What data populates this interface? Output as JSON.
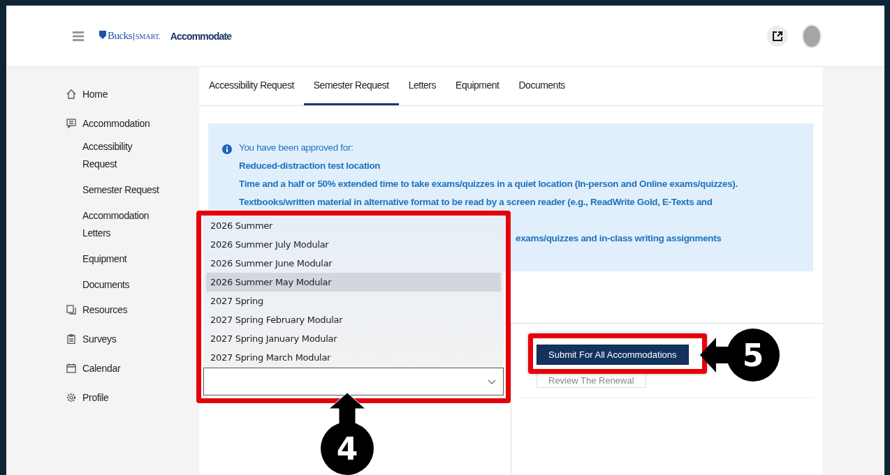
{
  "header": {
    "logo": {
      "name": "Bucks",
      "suffix": "SMART."
    },
    "product": "Accommodate"
  },
  "sidebar": {
    "items": [
      {
        "label": "Home"
      },
      {
        "label": "Accommodation",
        "children": [
          {
            "label": "Accessibility Request"
          },
          {
            "label": "Semester Request"
          },
          {
            "label": "Accommodation Letters"
          },
          {
            "label": "Equipment"
          },
          {
            "label": "Documents"
          }
        ]
      },
      {
        "label": "Resources"
      },
      {
        "label": "Surveys"
      },
      {
        "label": "Calendar"
      },
      {
        "label": "Profile"
      }
    ]
  },
  "tabs": [
    {
      "label": "Accessibility Request",
      "selected": false
    },
    {
      "label": "Semester Request",
      "selected": true
    },
    {
      "label": "Letters",
      "selected": false
    },
    {
      "label": "Equipment",
      "selected": false
    },
    {
      "label": "Documents",
      "selected": false
    }
  ],
  "notice": {
    "intro": "You have been approved for:",
    "items": [
      "Reduced-distraction test location",
      "Time and a half or 50% extended time to take exams/quizzes in a quiet location (In-person and Online exams/quizzes).",
      "Textbooks/written material in alternative format to be read by a screen reader (e.g., ReadWrite Gold, E-Texts and"
    ],
    "trailing": "exams/quizzes and in-class writing assignments"
  },
  "semester_dropdown": {
    "options": [
      {
        "label": "2026 Summer",
        "selected": false
      },
      {
        "label": "2026 Summer July Modular",
        "selected": false
      },
      {
        "label": "2026 Summer June Modular",
        "selected": false
      },
      {
        "label": "2026 Summer May Modular",
        "selected": true
      },
      {
        "label": "2027 Spring",
        "selected": false
      },
      {
        "label": "2027 Spring February Modular",
        "selected": false
      },
      {
        "label": "2027 Spring January Modular",
        "selected": false
      },
      {
        "label": "2027 Spring March Modular",
        "selected": false
      }
    ]
  },
  "buttons": {
    "submit": "Submit For All Accommodations",
    "review": "Review The Renewal"
  },
  "annotations": [
    {
      "label": "4"
    },
    {
      "label": "5"
    }
  ]
}
